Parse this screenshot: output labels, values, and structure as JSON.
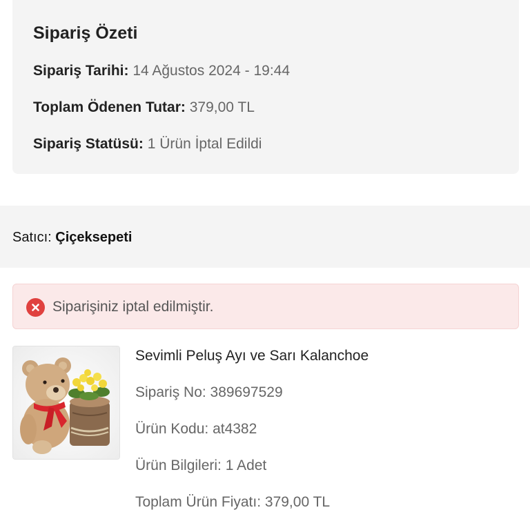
{
  "summary": {
    "title": "Sipariş Özeti",
    "date_label": "Sipariş Tarihi:",
    "date_value": "14 Ağustos 2024 - 19:44",
    "total_label": "Toplam Ödenen Tutar:",
    "total_value": "379,00 TL",
    "status_label": "Sipariş Statüsü:",
    "status_value": "1 Ürün İptal Edildi"
  },
  "seller": {
    "label": "Satıcı:",
    "name": "Çiçeksepeti"
  },
  "alert": {
    "icon": "error-x-icon",
    "color": "#e0413f",
    "message": "Siparişiniz iptal edilmiştir."
  },
  "product": {
    "name": "Sevimli Peluş Ayı ve Sarı Kalanchoe",
    "order_no": "Sipariş No: 389697529",
    "product_code": "Ürün Kodu: at4382",
    "info": "Ürün Bilgileri: 1 Adet",
    "total_price": "Toplam Ürün Fiyatı: 379,00 TL"
  },
  "colors": {
    "card_bg": "#f4f4f4",
    "alert_bg": "#fbe9e9",
    "alert_icon": "#e0413f",
    "muted_text": "#666666"
  }
}
